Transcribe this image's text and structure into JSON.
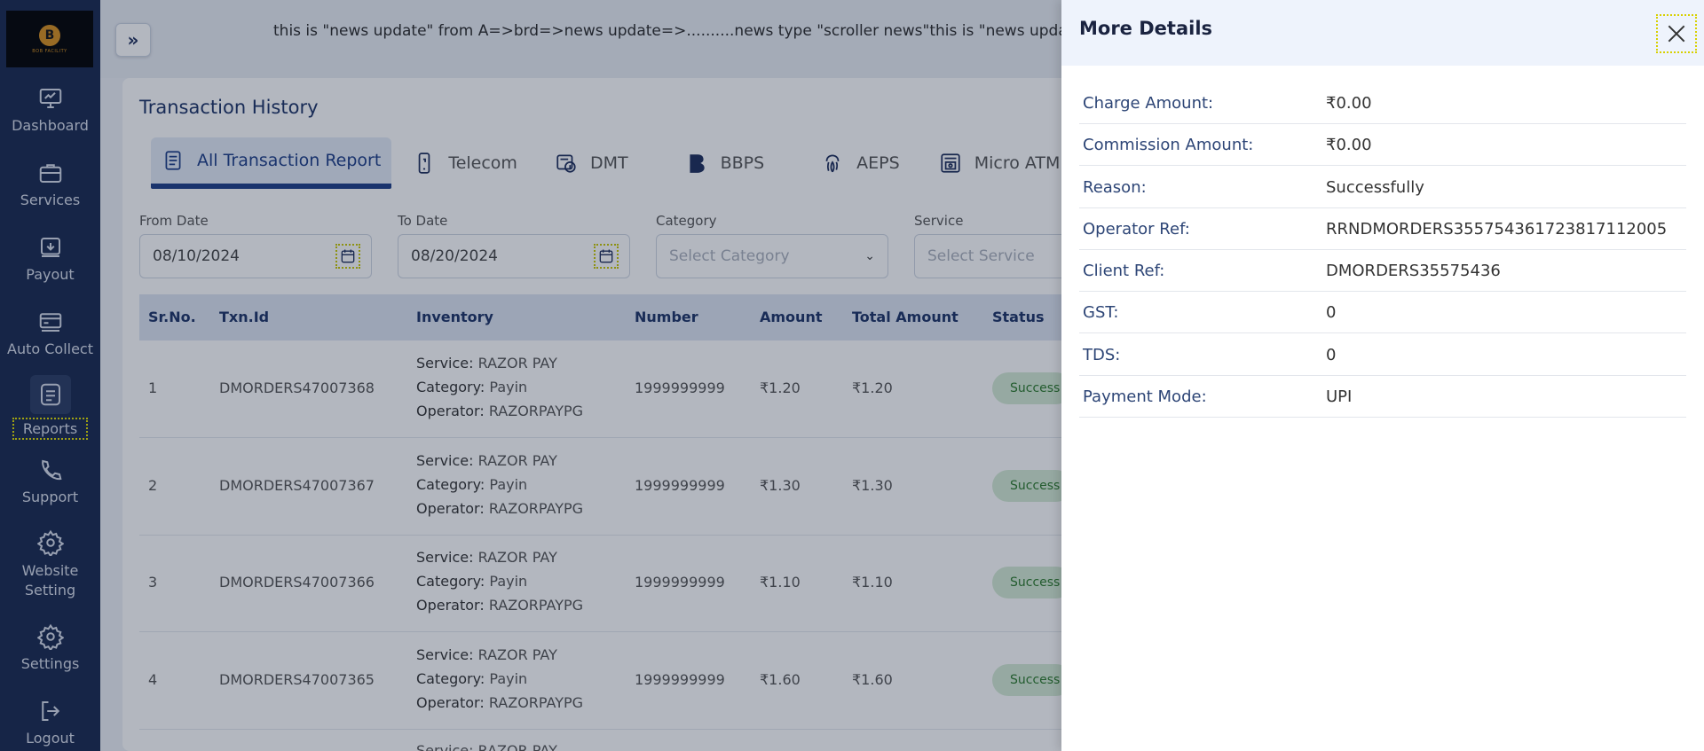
{
  "sidebar": {
    "logo_text": "B",
    "logo_tag": "BOB FACILITY",
    "items": [
      {
        "label": "Dashboard",
        "icon": "monitor-icon"
      },
      {
        "label": "Services",
        "icon": "briefcase-icon"
      },
      {
        "label": "Payout",
        "icon": "payout-icon"
      },
      {
        "label": "Auto Collect",
        "icon": "card-icon"
      },
      {
        "label": "Reports",
        "icon": "report-icon"
      },
      {
        "label": "Support",
        "icon": "phone-icon"
      },
      {
        "label": "Website Setting",
        "icon": "gear-icon"
      },
      {
        "label": "Settings",
        "icon": "gear-icon"
      },
      {
        "label": "Logout",
        "icon": "logout-icon"
      }
    ]
  },
  "header": {
    "toggle": "»",
    "ticker": "this is \"news update\" from A=>brd=>news update=>..........news type \"scroller news\"this is \"news update\" fro"
  },
  "page": {
    "title": "Transaction History",
    "tabs": [
      {
        "label": "All Transaction Report",
        "icon": "document-icon",
        "active": true
      },
      {
        "label": "Telecom",
        "icon": "mobile-icon"
      },
      {
        "label": "DMT",
        "icon": "money-transfer-icon"
      },
      {
        "label": "BBPS",
        "icon": "bbps-icon"
      },
      {
        "label": "AEPS",
        "icon": "fingerprint-icon"
      },
      {
        "label": "Micro ATM",
        "icon": "atm-icon"
      }
    ],
    "filters": {
      "from_date_label": "From Date",
      "from_date_value": "08/10/2024",
      "to_date_label": "To Date",
      "to_date_value": "08/20/2024",
      "category_label": "Category",
      "category_placeholder": "Select Category",
      "service_label": "Service",
      "service_placeholder": "Select Service"
    }
  },
  "table": {
    "headers": [
      "Sr.No.",
      "Txn.Id",
      "Inventory",
      "Number",
      "Amount",
      "Total Amount",
      "Status"
    ],
    "inventory_labels": {
      "service": "Service:",
      "category": "Category:",
      "operator": "Operator:"
    },
    "rows": [
      {
        "sr": "1",
        "txn": "DMORDERS47007368",
        "service": "RAZOR PAY",
        "category": "Payin",
        "operator": "RAZORPAYPG",
        "number": "1999999999",
        "amount": "₹1.20",
        "total": "₹1.20",
        "status": "Success"
      },
      {
        "sr": "2",
        "txn": "DMORDERS47007367",
        "service": "RAZOR PAY",
        "category": "Payin",
        "operator": "RAZORPAYPG",
        "number": "1999999999",
        "amount": "₹1.30",
        "total": "₹1.30",
        "status": "Success"
      },
      {
        "sr": "3",
        "txn": "DMORDERS47007366",
        "service": "RAZOR PAY",
        "category": "Payin",
        "operator": "RAZORPAYPG",
        "number": "1999999999",
        "amount": "₹1.10",
        "total": "₹1.10",
        "status": "Success"
      },
      {
        "sr": "4",
        "txn": "DMORDERS47007365",
        "service": "RAZOR PAY",
        "category": "Payin",
        "operator": "RAZORPAYPG",
        "number": "1999999999",
        "amount": "₹1.60",
        "total": "₹1.60",
        "status": "Success"
      }
    ],
    "partial_row_text": "Service: RAZOR PAY"
  },
  "drawer": {
    "title": "More Details",
    "details": [
      {
        "key": "Charge Amount:",
        "value": "₹0.00"
      },
      {
        "key": "Commission Amount:",
        "value": "₹0.00"
      },
      {
        "key": "Reason:",
        "value": "Successfully"
      },
      {
        "key": "Operator Ref:",
        "value": "RRNDMORDERS355754361723817112005"
      },
      {
        "key": "Client Ref:",
        "value": "DMORDERS35575436"
      },
      {
        "key": "GST:",
        "value": "0"
      },
      {
        "key": "TDS:",
        "value": "0"
      },
      {
        "key": "Payment Mode:",
        "value": "UPI"
      }
    ]
  },
  "colors": {
    "sidebar": "#19294f",
    "accent": "#1c3d86",
    "success_bg": "#d5ebd4",
    "drawer_header": "#eef3fc"
  }
}
